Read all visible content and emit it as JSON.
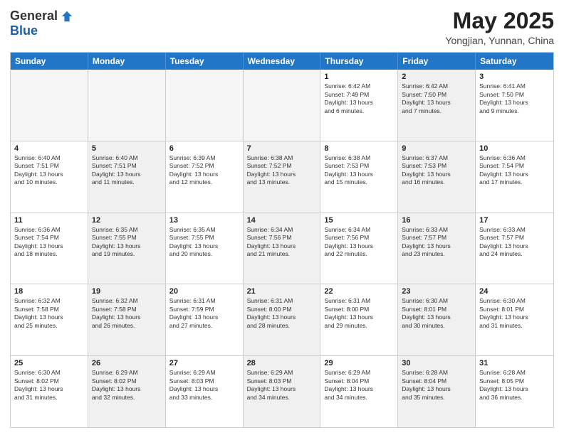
{
  "logo": {
    "general": "General",
    "blue": "Blue"
  },
  "title": "May 2025",
  "location": "Yongjian, Yunnan, China",
  "days_of_week": [
    "Sunday",
    "Monday",
    "Tuesday",
    "Wednesday",
    "Thursday",
    "Friday",
    "Saturday"
  ],
  "weeks": [
    [
      {
        "day": "",
        "info": "",
        "shaded": true
      },
      {
        "day": "",
        "info": "",
        "shaded": true
      },
      {
        "day": "",
        "info": "",
        "shaded": true
      },
      {
        "day": "",
        "info": "",
        "shaded": true
      },
      {
        "day": "1",
        "info": "Sunrise: 6:42 AM\nSunset: 7:49 PM\nDaylight: 13 hours\nand 6 minutes.",
        "shaded": false
      },
      {
        "day": "2",
        "info": "Sunrise: 6:42 AM\nSunset: 7:50 PM\nDaylight: 13 hours\nand 7 minutes.",
        "shaded": true
      },
      {
        "day": "3",
        "info": "Sunrise: 6:41 AM\nSunset: 7:50 PM\nDaylight: 13 hours\nand 9 minutes.",
        "shaded": false
      }
    ],
    [
      {
        "day": "4",
        "info": "Sunrise: 6:40 AM\nSunset: 7:51 PM\nDaylight: 13 hours\nand 10 minutes.",
        "shaded": false
      },
      {
        "day": "5",
        "info": "Sunrise: 6:40 AM\nSunset: 7:51 PM\nDaylight: 13 hours\nand 11 minutes.",
        "shaded": true
      },
      {
        "day": "6",
        "info": "Sunrise: 6:39 AM\nSunset: 7:52 PM\nDaylight: 13 hours\nand 12 minutes.",
        "shaded": false
      },
      {
        "day": "7",
        "info": "Sunrise: 6:38 AM\nSunset: 7:52 PM\nDaylight: 13 hours\nand 13 minutes.",
        "shaded": true
      },
      {
        "day": "8",
        "info": "Sunrise: 6:38 AM\nSunset: 7:53 PM\nDaylight: 13 hours\nand 15 minutes.",
        "shaded": false
      },
      {
        "day": "9",
        "info": "Sunrise: 6:37 AM\nSunset: 7:53 PM\nDaylight: 13 hours\nand 16 minutes.",
        "shaded": true
      },
      {
        "day": "10",
        "info": "Sunrise: 6:36 AM\nSunset: 7:54 PM\nDaylight: 13 hours\nand 17 minutes.",
        "shaded": false
      }
    ],
    [
      {
        "day": "11",
        "info": "Sunrise: 6:36 AM\nSunset: 7:54 PM\nDaylight: 13 hours\nand 18 minutes.",
        "shaded": false
      },
      {
        "day": "12",
        "info": "Sunrise: 6:35 AM\nSunset: 7:55 PM\nDaylight: 13 hours\nand 19 minutes.",
        "shaded": true
      },
      {
        "day": "13",
        "info": "Sunrise: 6:35 AM\nSunset: 7:55 PM\nDaylight: 13 hours\nand 20 minutes.",
        "shaded": false
      },
      {
        "day": "14",
        "info": "Sunrise: 6:34 AM\nSunset: 7:56 PM\nDaylight: 13 hours\nand 21 minutes.",
        "shaded": true
      },
      {
        "day": "15",
        "info": "Sunrise: 6:34 AM\nSunset: 7:56 PM\nDaylight: 13 hours\nand 22 minutes.",
        "shaded": false
      },
      {
        "day": "16",
        "info": "Sunrise: 6:33 AM\nSunset: 7:57 PM\nDaylight: 13 hours\nand 23 minutes.",
        "shaded": true
      },
      {
        "day": "17",
        "info": "Sunrise: 6:33 AM\nSunset: 7:57 PM\nDaylight: 13 hours\nand 24 minutes.",
        "shaded": false
      }
    ],
    [
      {
        "day": "18",
        "info": "Sunrise: 6:32 AM\nSunset: 7:58 PM\nDaylight: 13 hours\nand 25 minutes.",
        "shaded": false
      },
      {
        "day": "19",
        "info": "Sunrise: 6:32 AM\nSunset: 7:58 PM\nDaylight: 13 hours\nand 26 minutes.",
        "shaded": true
      },
      {
        "day": "20",
        "info": "Sunrise: 6:31 AM\nSunset: 7:59 PM\nDaylight: 13 hours\nand 27 minutes.",
        "shaded": false
      },
      {
        "day": "21",
        "info": "Sunrise: 6:31 AM\nSunset: 8:00 PM\nDaylight: 13 hours\nand 28 minutes.",
        "shaded": true
      },
      {
        "day": "22",
        "info": "Sunrise: 6:31 AM\nSunset: 8:00 PM\nDaylight: 13 hours\nand 29 minutes.",
        "shaded": false
      },
      {
        "day": "23",
        "info": "Sunrise: 6:30 AM\nSunset: 8:01 PM\nDaylight: 13 hours\nand 30 minutes.",
        "shaded": true
      },
      {
        "day": "24",
        "info": "Sunrise: 6:30 AM\nSunset: 8:01 PM\nDaylight: 13 hours\nand 31 minutes.",
        "shaded": false
      }
    ],
    [
      {
        "day": "25",
        "info": "Sunrise: 6:30 AM\nSunset: 8:02 PM\nDaylight: 13 hours\nand 31 minutes.",
        "shaded": false
      },
      {
        "day": "26",
        "info": "Sunrise: 6:29 AM\nSunset: 8:02 PM\nDaylight: 13 hours\nand 32 minutes.",
        "shaded": true
      },
      {
        "day": "27",
        "info": "Sunrise: 6:29 AM\nSunset: 8:03 PM\nDaylight: 13 hours\nand 33 minutes.",
        "shaded": false
      },
      {
        "day": "28",
        "info": "Sunrise: 6:29 AM\nSunset: 8:03 PM\nDaylight: 13 hours\nand 34 minutes.",
        "shaded": true
      },
      {
        "day": "29",
        "info": "Sunrise: 6:29 AM\nSunset: 8:04 PM\nDaylight: 13 hours\nand 34 minutes.",
        "shaded": false
      },
      {
        "day": "30",
        "info": "Sunrise: 6:28 AM\nSunset: 8:04 PM\nDaylight: 13 hours\nand 35 minutes.",
        "shaded": true
      },
      {
        "day": "31",
        "info": "Sunrise: 6:28 AM\nSunset: 8:05 PM\nDaylight: 13 hours\nand 36 minutes.",
        "shaded": false
      }
    ]
  ]
}
